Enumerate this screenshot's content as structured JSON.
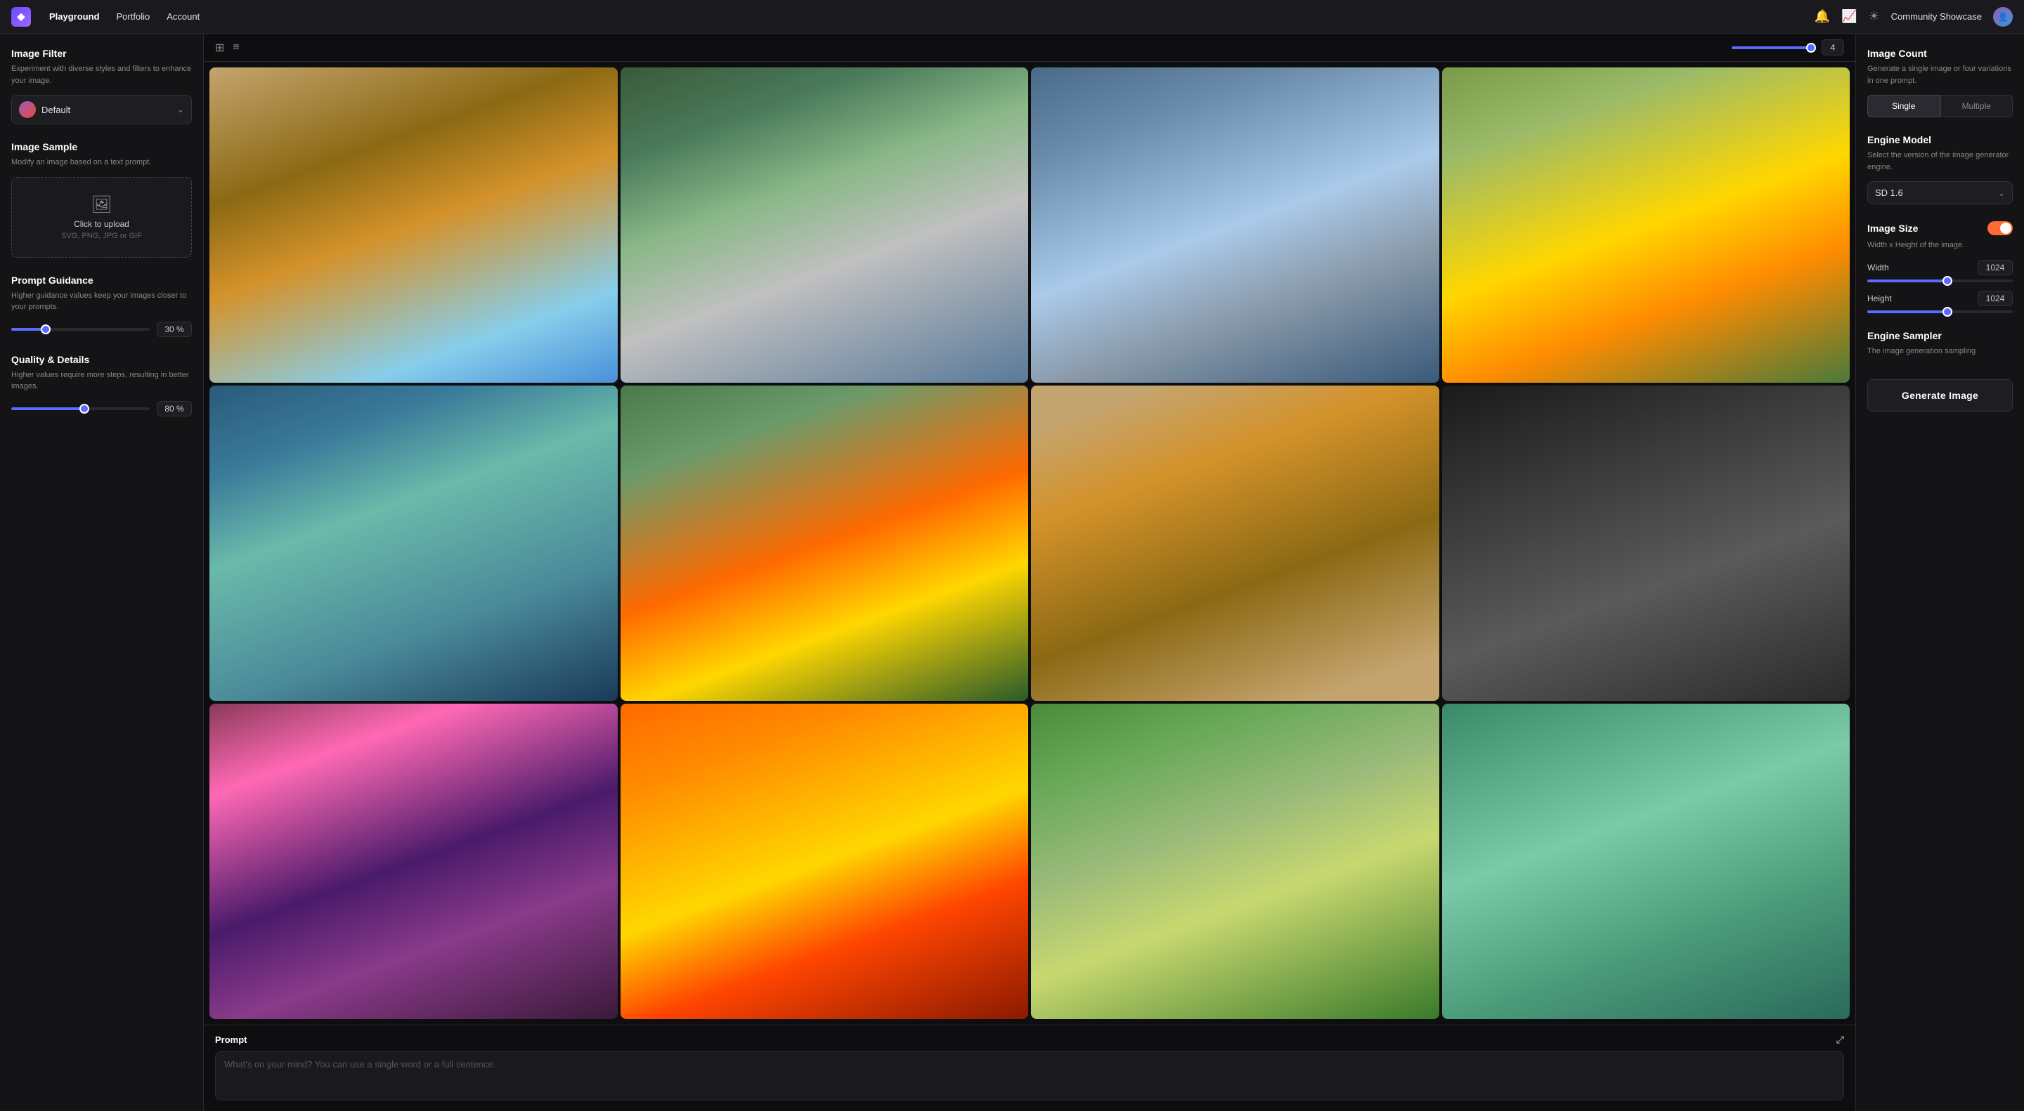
{
  "nav": {
    "logo": "◆",
    "links": [
      "Playground",
      "Portfolio",
      "Account"
    ],
    "active_link": "Playground",
    "community_label": "Community Showcase",
    "icons": {
      "bell": "🔔",
      "activity": "⚡",
      "sun": "☀"
    }
  },
  "left_sidebar": {
    "image_filter": {
      "title": "Image Filter",
      "desc": "Experiment with diverse styles and filters to enhance your image.",
      "selected": "Default"
    },
    "image_sample": {
      "title": "Image Sample",
      "desc": "Modify an image based on a text prompt.",
      "upload_label": "Click to upload",
      "upload_hint": "SVG, PNG, JPG or GIF"
    },
    "prompt_guidance": {
      "title": "Prompt Guidance",
      "desc": "Higher guidance values keep your images closer to your prompts.",
      "value": "30 %",
      "fill_pct": 25
    },
    "quality_details": {
      "title": "Quality & Details",
      "desc": "Higher values require more steps, resulting in better images.",
      "value": "80 %",
      "fill_pct": 53
    }
  },
  "toolbar": {
    "grid_icon": "⊞",
    "list_icon": "≡",
    "count": "4"
  },
  "prompt": {
    "label": "Prompt",
    "placeholder": "What's on your mind? You can use a single word or a full sentence."
  },
  "right_sidebar": {
    "image_count": {
      "title": "Image Count",
      "desc": "Generate a single image or four variations in one prompt.",
      "single_label": "Single",
      "multiple_label": "Multiple",
      "active": "Single"
    },
    "engine_model": {
      "title": "Engine Model",
      "desc": "Select the version of the image generator engine.",
      "selected": "SD 1.6"
    },
    "image_size": {
      "title": "Image Size",
      "desc": "Width x Height of the image.",
      "enabled": true,
      "width_label": "Width",
      "width_value": "1024",
      "width_fill_pct": 55,
      "height_label": "Height",
      "height_value": "1024",
      "height_fill_pct": 55
    },
    "engine_sampler": {
      "title": "Engine Sampler",
      "desc": "The image generation sampling"
    },
    "generate_button": "Generate Image"
  }
}
